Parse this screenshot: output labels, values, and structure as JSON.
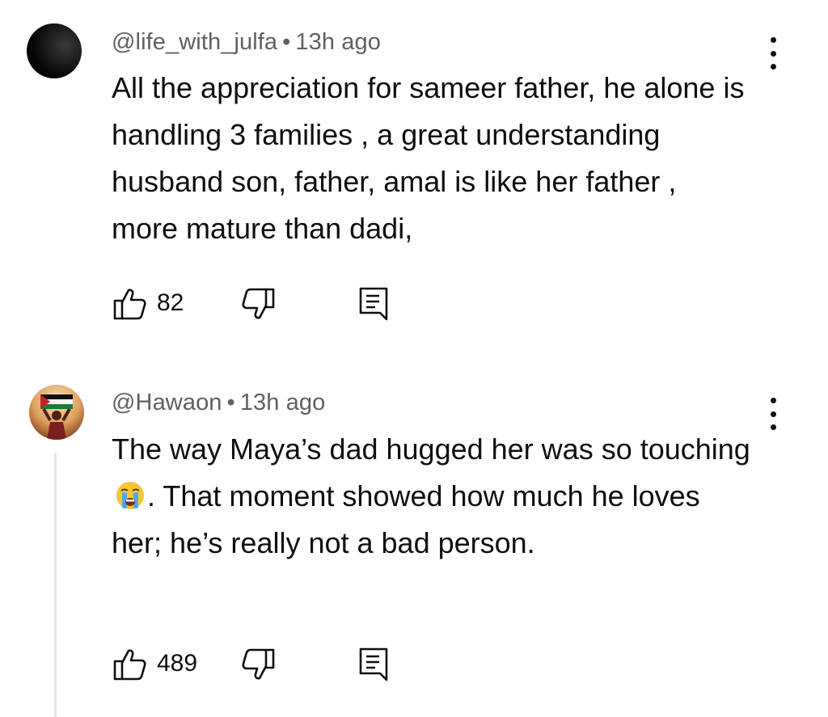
{
  "comments": [
    {
      "author": "@life_with_julfa",
      "separator": "•",
      "time": "13h ago",
      "text": "All the appreciation for sameer father, he alone is handling 3 families , a great understanding husband son, father, amal is like her father , more mature than dadi,",
      "likes": "82",
      "avatar_icon": "dark-circle-avatar",
      "actions": [
        "like-icon",
        "dislike-icon",
        "reply-icon"
      ],
      "menu_icon": "more-vert-icon"
    },
    {
      "author": "@Hawaon",
      "separator": "•",
      "time": "13h ago",
      "text_before_emoji": "The way Maya’s dad hugged her was so touching ",
      "emoji": "loudly-crying-face-emoji",
      "text_after_emoji": ". That moment showed how much he loves her; he’s really not a bad person.",
      "likes": "489",
      "avatar_icon": "person-holding-flag-avatar",
      "actions": [
        "like-icon",
        "dislike-icon",
        "reply-icon"
      ],
      "menu_icon": "more-vert-icon"
    }
  ],
  "colors": {
    "text": "#0f0f0f",
    "meta": "#606060",
    "thread_line": "#e5e5e5",
    "background": "#ffffff"
  }
}
